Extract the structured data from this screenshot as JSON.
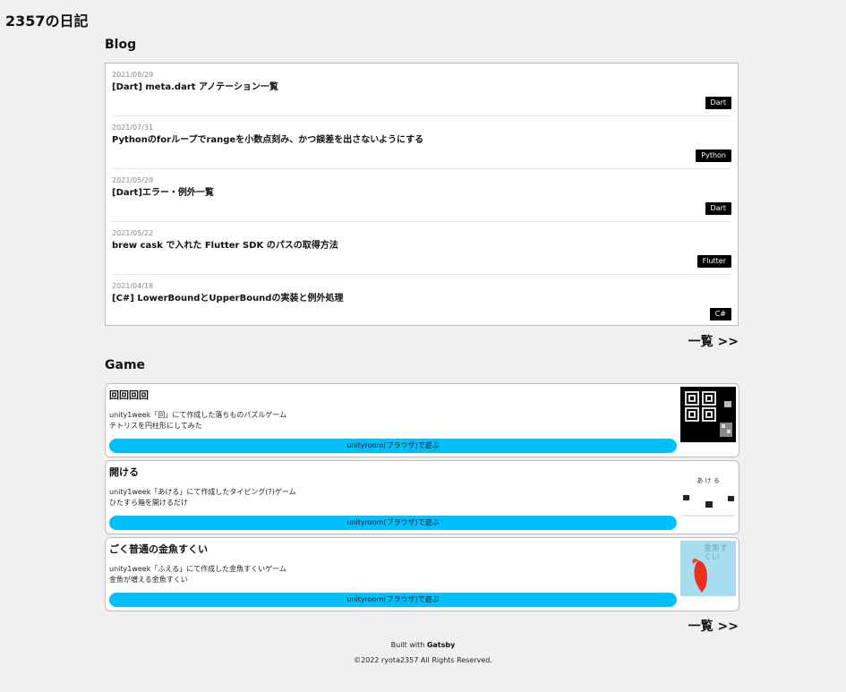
{
  "site": {
    "title": "2357の日記"
  },
  "blog": {
    "heading": "Blog",
    "posts": [
      {
        "date": "2021/08/29",
        "title": "[Dart] meta.dart アノテーション一覧",
        "tag": "Dart"
      },
      {
        "date": "2021/07/31",
        "title": "Pythonのforループでrangeを小数点刻み、かつ誤差を出さないようにする",
        "tag": "Python"
      },
      {
        "date": "2021/05/29",
        "title": "[Dart]エラー・例外一覧",
        "tag": "Dart"
      },
      {
        "date": "2021/05/22",
        "title": "brew cask で入れた Flutter SDK のパスの取得方法",
        "tag": "Flutter"
      },
      {
        "date": "2021/04/18",
        "title": "[C#] LowerBoundとUpperBoundの実装と例外処理",
        "tag": "C#"
      }
    ],
    "more_label": "一覧 >>"
  },
  "game": {
    "heading": "Game",
    "items": [
      {
        "name": "回回回回",
        "desc1": "unity1week「回」にて作成した落ちものパズルゲーム",
        "desc2": "テトリスを円柱形にしてみた",
        "button": "unityroom(ブラウザ)で遊ぶ"
      },
      {
        "name": "開ける",
        "desc1": "unity1week「あける」にて作成したタイピング(?)ゲーム",
        "desc2": "ひたすら箱を開けるだけ",
        "button": "unityroom(ブラウザ)で遊ぶ",
        "thumb_text": "あ け る"
      },
      {
        "name": "ごく普通の金魚すくい",
        "desc1": "unity1week「ふえる」にて作成した金魚すくいゲーム",
        "desc2": "金魚が増える金魚すくい",
        "button": "unityroom(ブラウザ)で遊ぶ",
        "thumb_text": "金魚すくい"
      }
    ],
    "more_label": "一覧 >>"
  },
  "footer": {
    "built_prefix": "Built with ",
    "built_name": "Gatsby",
    "copyright": "©2022 ryota2357 All Rights Reserved."
  },
  "colors": {
    "tag_bg": "#000000",
    "button_bg": "#00bfff",
    "page_bg": "#f0f0f0"
  }
}
